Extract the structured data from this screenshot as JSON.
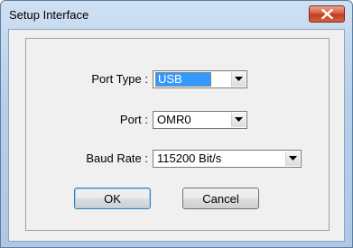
{
  "window": {
    "title": "Setup Interface",
    "close_icon": "close-x-icon"
  },
  "form": {
    "port_type": {
      "label": "Port Type :",
      "value": "USB"
    },
    "port": {
      "label": "Port :",
      "value": "OMR0"
    },
    "baud_rate": {
      "label": "Baud Rate :",
      "value": "115200 Bit/s"
    }
  },
  "buttons": {
    "ok": "OK",
    "cancel": "Cancel"
  },
  "colors": {
    "selection": "#3399ff",
    "close_button": "#c9462a",
    "title_bar": "#b9d1ea"
  }
}
